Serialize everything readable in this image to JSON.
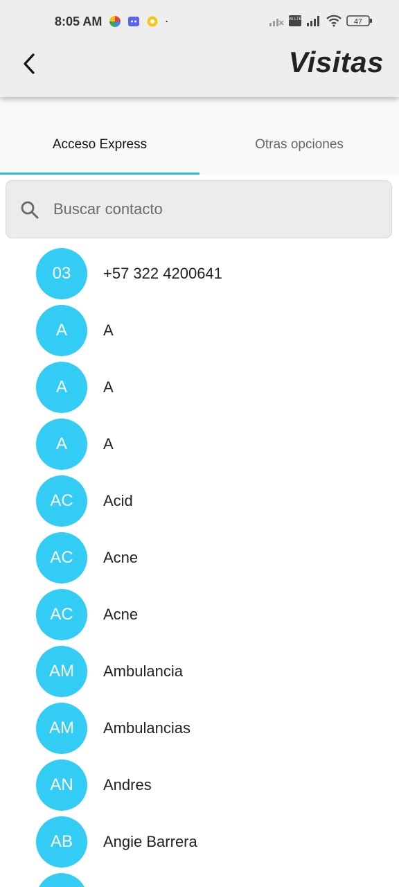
{
  "status_bar": {
    "time": "8:05 AM",
    "volte_label": "Vo LTE",
    "battery": "47"
  },
  "app_bar": {
    "title": "Visitas",
    "back_icon": "chevron-left-icon"
  },
  "tabs": [
    {
      "label": "Acceso Express",
      "selected": true
    },
    {
      "label": "Otras opciones",
      "selected": false
    }
  ],
  "search": {
    "placeholder": "Buscar contacto",
    "value": ""
  },
  "colors": {
    "accent": "#29b6e6",
    "avatar_bg": "#33ccf5",
    "header_bg": "#eeeeee"
  },
  "contacts": [
    {
      "initials": "03",
      "name": "+57 322 4200641"
    },
    {
      "initials": "A",
      "name": "A"
    },
    {
      "initials": "A",
      "name": "A"
    },
    {
      "initials": "A",
      "name": "A"
    },
    {
      "initials": "AC",
      "name": "Acid"
    },
    {
      "initials": "AC",
      "name": "Acne"
    },
    {
      "initials": "AC",
      "name": "Acne"
    },
    {
      "initials": "AM",
      "name": "Ambulancia"
    },
    {
      "initials": "AM",
      "name": "Ambulancias"
    },
    {
      "initials": "AN",
      "name": "Andres"
    },
    {
      "initials": "AB",
      "name": "Angie Barrera"
    },
    {
      "initials": "",
      "name": ""
    }
  ]
}
